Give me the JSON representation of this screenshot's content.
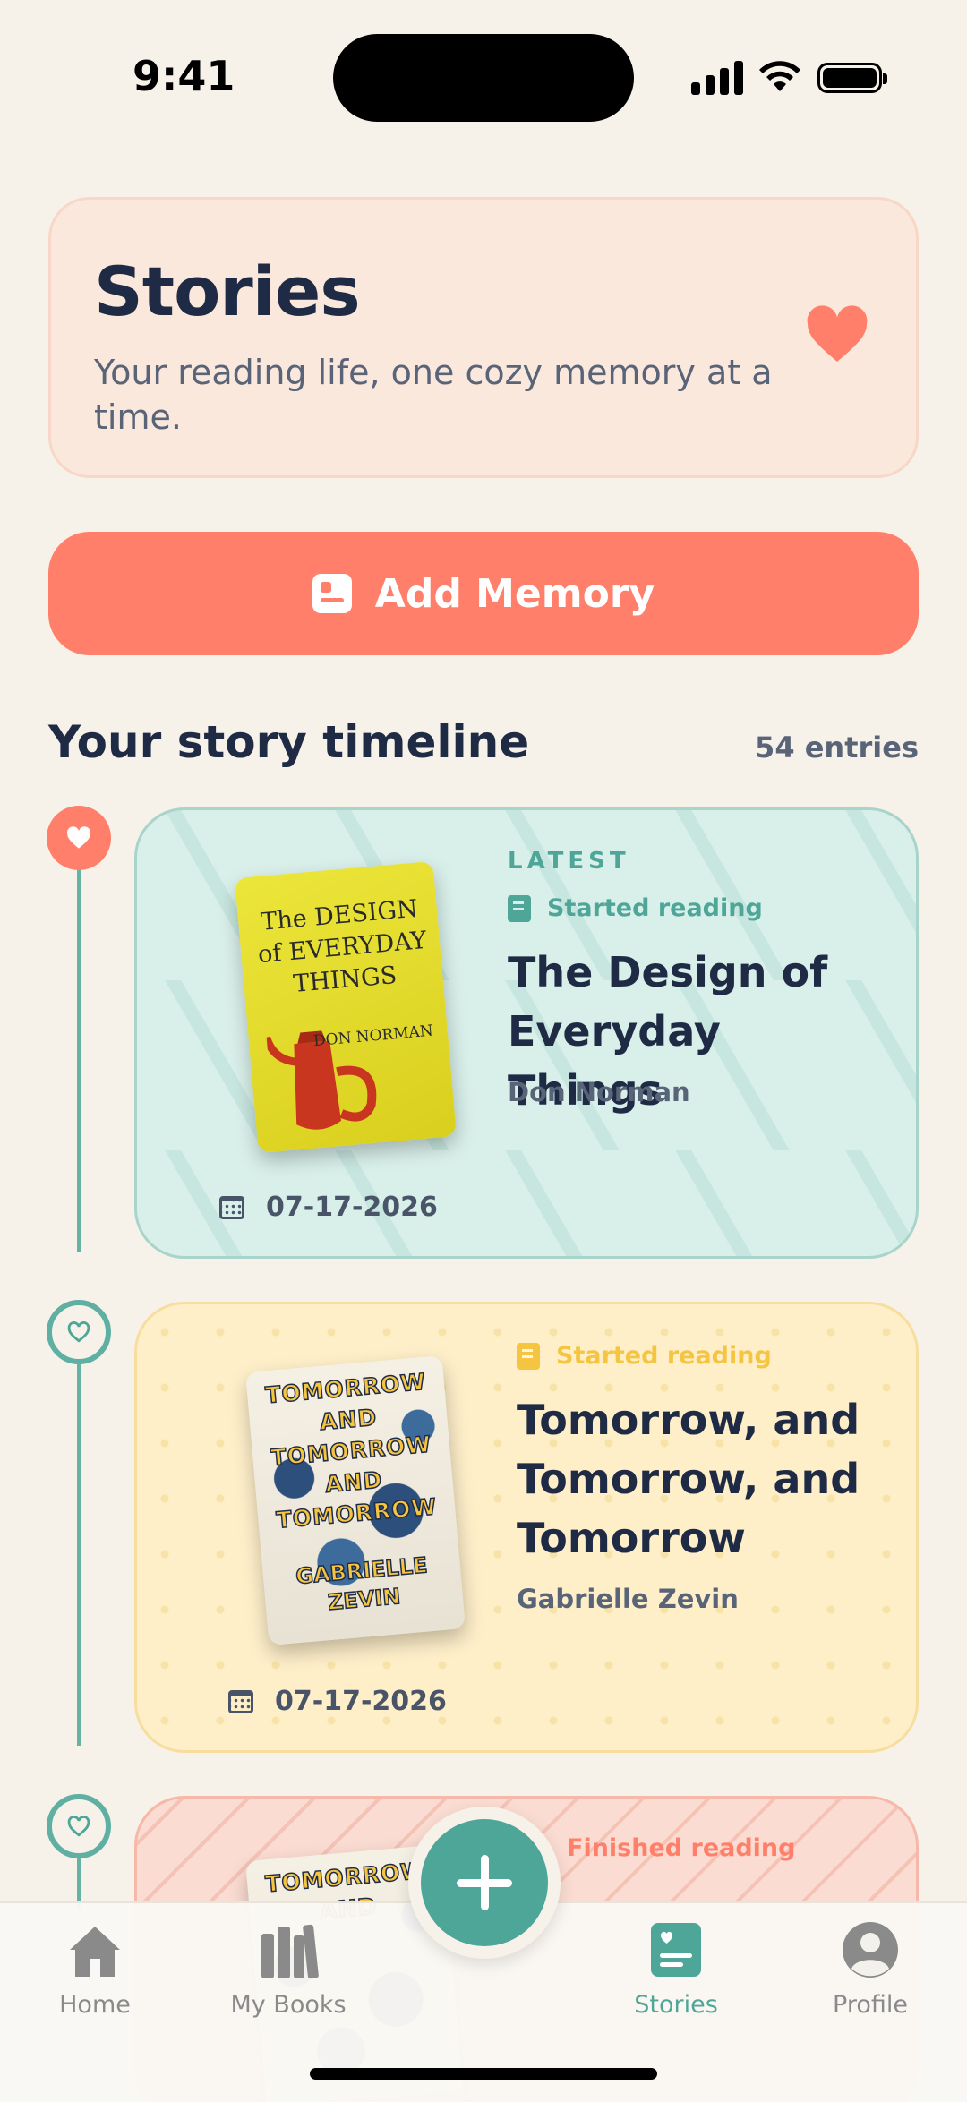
{
  "status_bar": {
    "time": "9:41"
  },
  "header": {
    "title": "Stories",
    "subtitle": "Your reading life, one cozy memory at a time."
  },
  "add_memory": {
    "label": "Add Memory"
  },
  "timeline": {
    "title": "Your story timeline",
    "entries_count": "54 entries",
    "items": [
      {
        "badge": "LATEST",
        "status": "Started reading",
        "title": "The Design of Everyday Things",
        "author": "Don Norman",
        "date": "07-17-2026",
        "cover_title": "The DESIGN of EVERYDAY THINGS",
        "cover_author": "DON NORMAN",
        "color": "#D9EFEA",
        "status_color": "#4DA697"
      },
      {
        "status": "Started reading",
        "title": "Tomorrow, and Tomorrow, and Tomorrow",
        "author": "Gabrielle Zevin",
        "date": "07-17-2026",
        "cover_title": "TOMORROW AND TOMORROW AND TOMORROW",
        "cover_author": "GABRIELLE ZEVIN",
        "color": "#FEEFC9",
        "status_color": "#F5C542"
      },
      {
        "status": "Finished reading",
        "cover_title": "TOMORROW AND",
        "color": "#FBDCD2",
        "status_color": "#FF7F6A"
      }
    ]
  },
  "nav": {
    "tabs": [
      {
        "label": "Home",
        "icon": "home-icon"
      },
      {
        "label": "My Books",
        "icon": "books-icon"
      },
      {
        "label": "Stories",
        "icon": "stories-icon",
        "active": true
      },
      {
        "label": "Profile",
        "icon": "profile-icon"
      }
    ],
    "fab_icon": "plus-icon"
  },
  "colors": {
    "accent": "#FF7F6A",
    "teal": "#4DA697",
    "background": "#F7F2E9",
    "text": "#1F2B45"
  }
}
